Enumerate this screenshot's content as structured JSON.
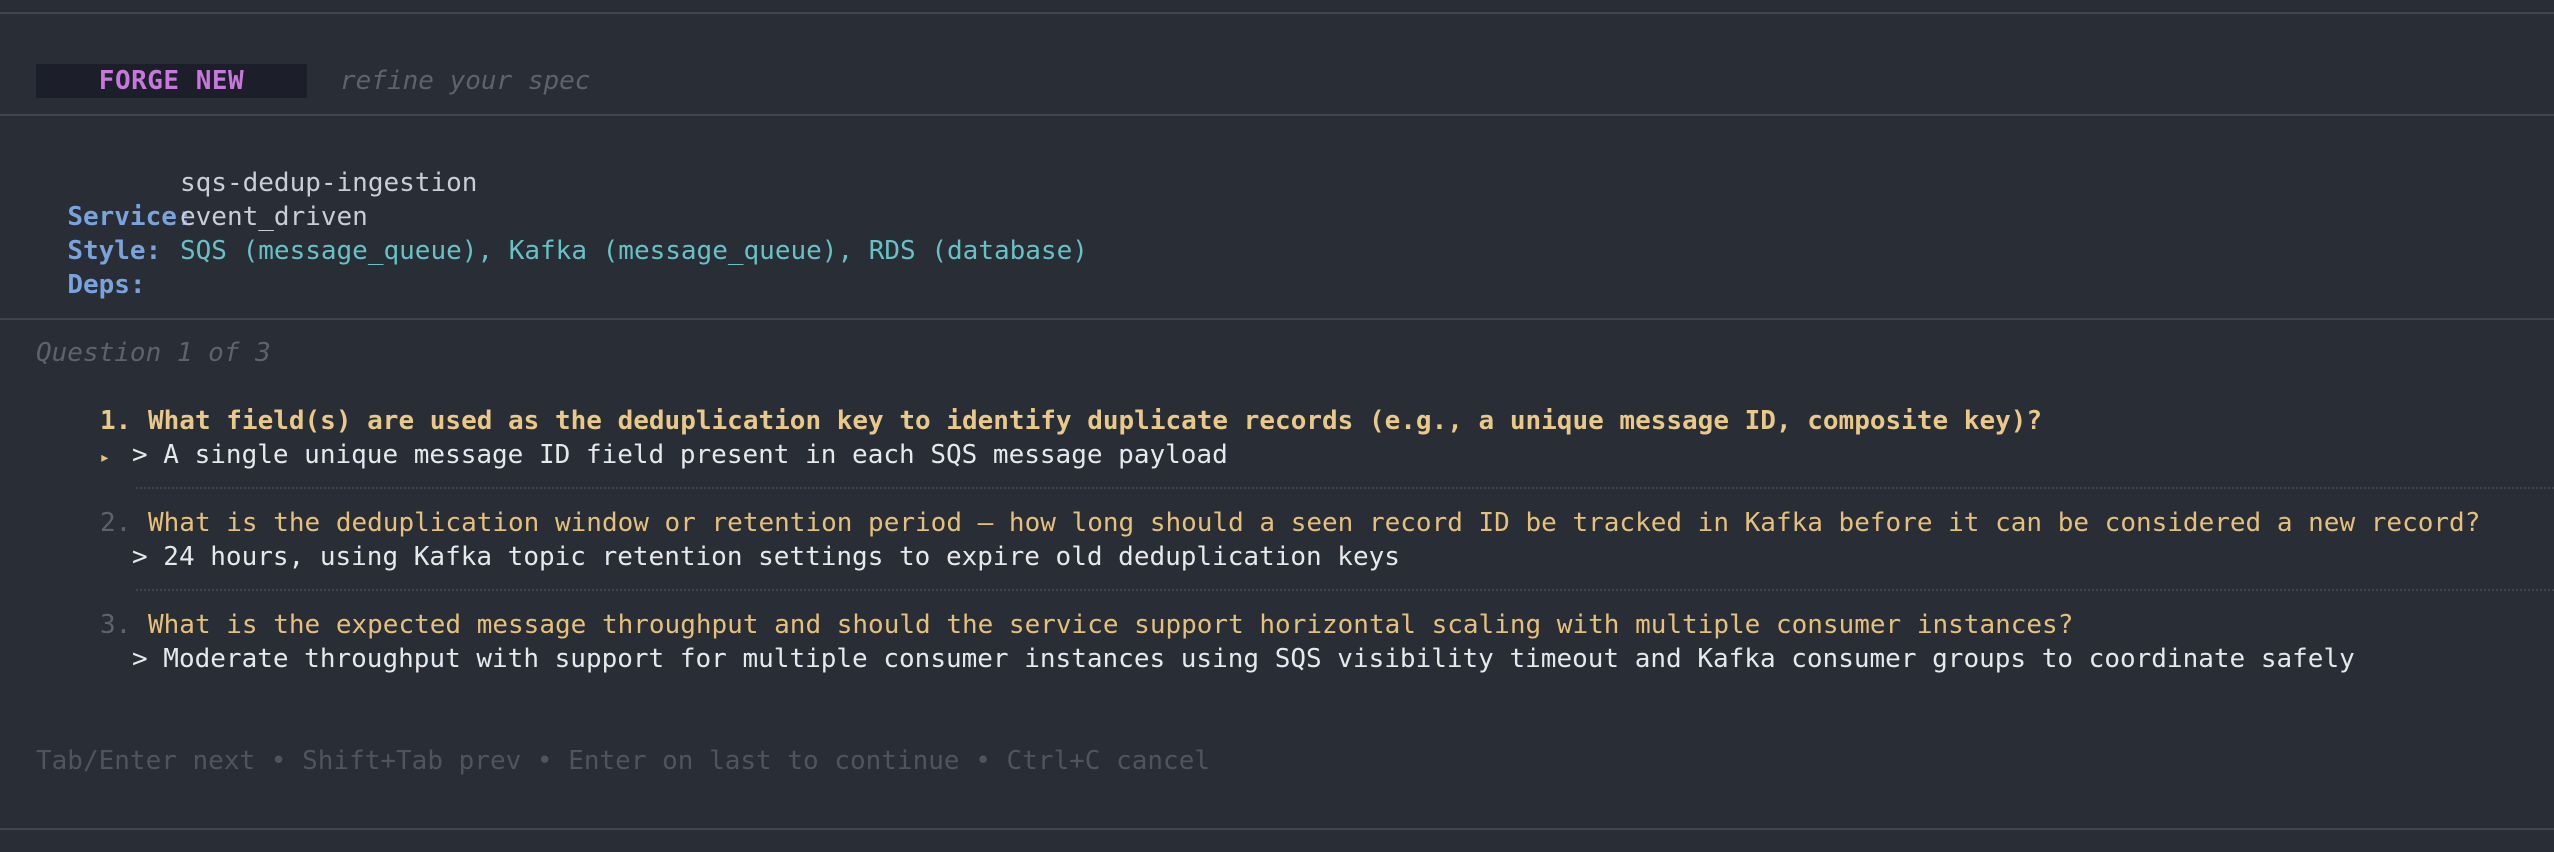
{
  "header": {
    "badge": "FORGE NEW",
    "subtitle": "refine your spec"
  },
  "spec": {
    "service_label": "Service:",
    "service_value": "sqs-dedup-ingestion",
    "style_label": "Style:",
    "style_value": "event_driven",
    "deps_label": "Deps:",
    "deps_value": "SQS (message_queue), Kafka (message_queue), RDS (database)"
  },
  "progress": "Question 1 of 3",
  "questions": [
    {
      "number": "1.",
      "marker": "▸",
      "text": "What field(s) are used as the deduplication key to identify duplicate records (e.g., a unique message ID, composite key)?",
      "answer": "> A single unique message ID field present in each SQS message payload",
      "active": true
    },
    {
      "number": "2.",
      "text": "What is the deduplication window or retention period — how long should a seen record ID be tracked in Kafka before it can be considered a new record?",
      "answer": "> 24 hours, using Kafka topic retention settings to expire old deduplication keys",
      "active": false
    },
    {
      "number": "3.",
      "text": "What is the expected message throughput and should the service support horizontal scaling with multiple consumer instances?",
      "answer": "> Moderate throughput with support for multiple consumer instances using SQS visibility timeout and Kafka consumer groups to coordinate safely",
      "active": false
    }
  ],
  "footer": "Tab/Enter next • Shift+Tab prev • Enter on last to continue • Ctrl+C cancel",
  "colors": {
    "background": "#292d35",
    "badge_text": "#c678dd",
    "label": "#7aa2dc",
    "dependency": "#66c2c6",
    "question": "#e5c07b"
  }
}
